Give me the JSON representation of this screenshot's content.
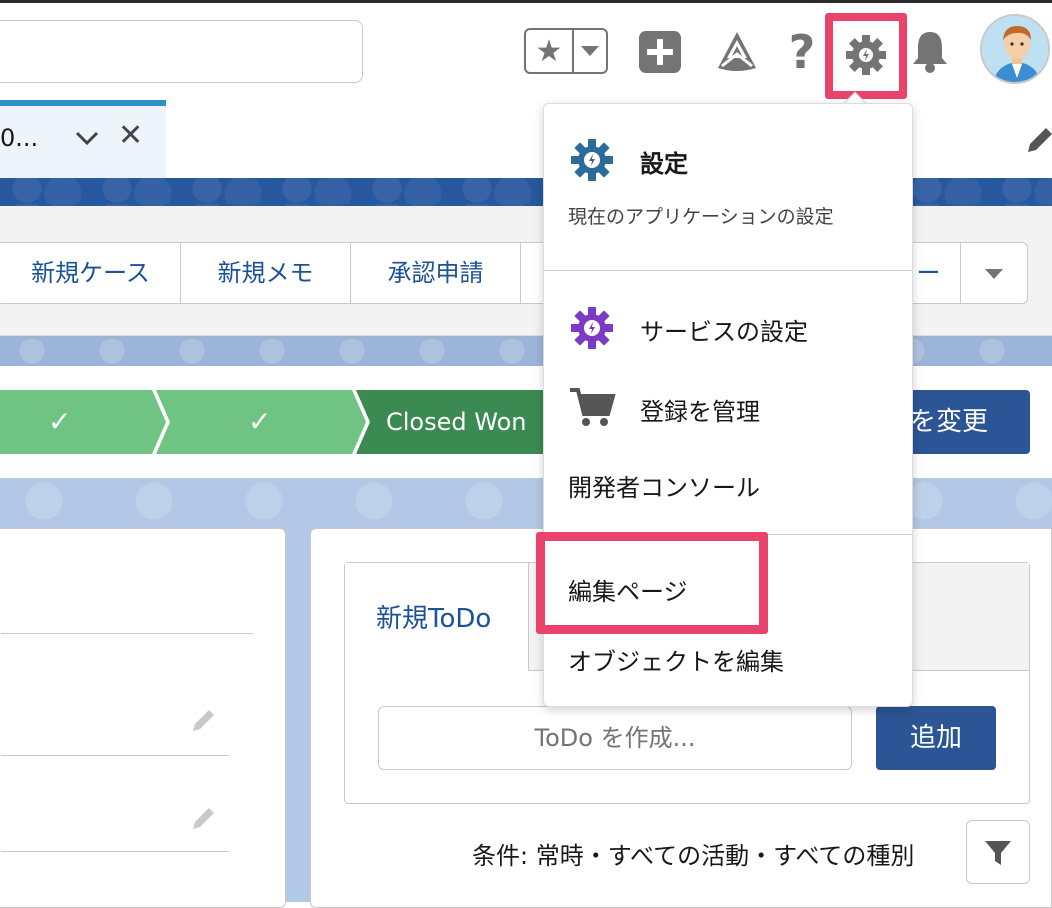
{
  "header": {
    "help_glyph": "?",
    "fav_glyph": "★"
  },
  "tab": {
    "label": "0...",
    "close_glyph": "✕"
  },
  "actions": {
    "new_case": "新規ケース",
    "new_note": "新規メモ",
    "approval": "承認申請",
    "partial_dash": "ー"
  },
  "path": {
    "check_glyph": "✓",
    "current_stage": "Closed Won",
    "change_button": "を変更"
  },
  "activity": {
    "tab_new_todo": "新規ToDo",
    "todo_placeholder": "ToDo を作成...",
    "add_button": "追加",
    "filter_text": "条件: 常時・すべての活動・すべての種別"
  },
  "menu": {
    "setup_title": "設定",
    "setup_subtitle": "現在のアプリケーションの設定",
    "service_setup": "サービスの設定",
    "manage_subscription": "登録を管理",
    "developer_console": "開発者コンソール",
    "edit_page": "編集ページ",
    "edit_object": "オブジェクトを編集"
  },
  "colors": {
    "highlight": "#e9426b",
    "brand_blue": "#2c5595",
    "path_complete": "#6fc483",
    "path_current": "#3b8a52",
    "setup_gear": "#2e6b99",
    "service_gear": "#7b3bc4"
  }
}
